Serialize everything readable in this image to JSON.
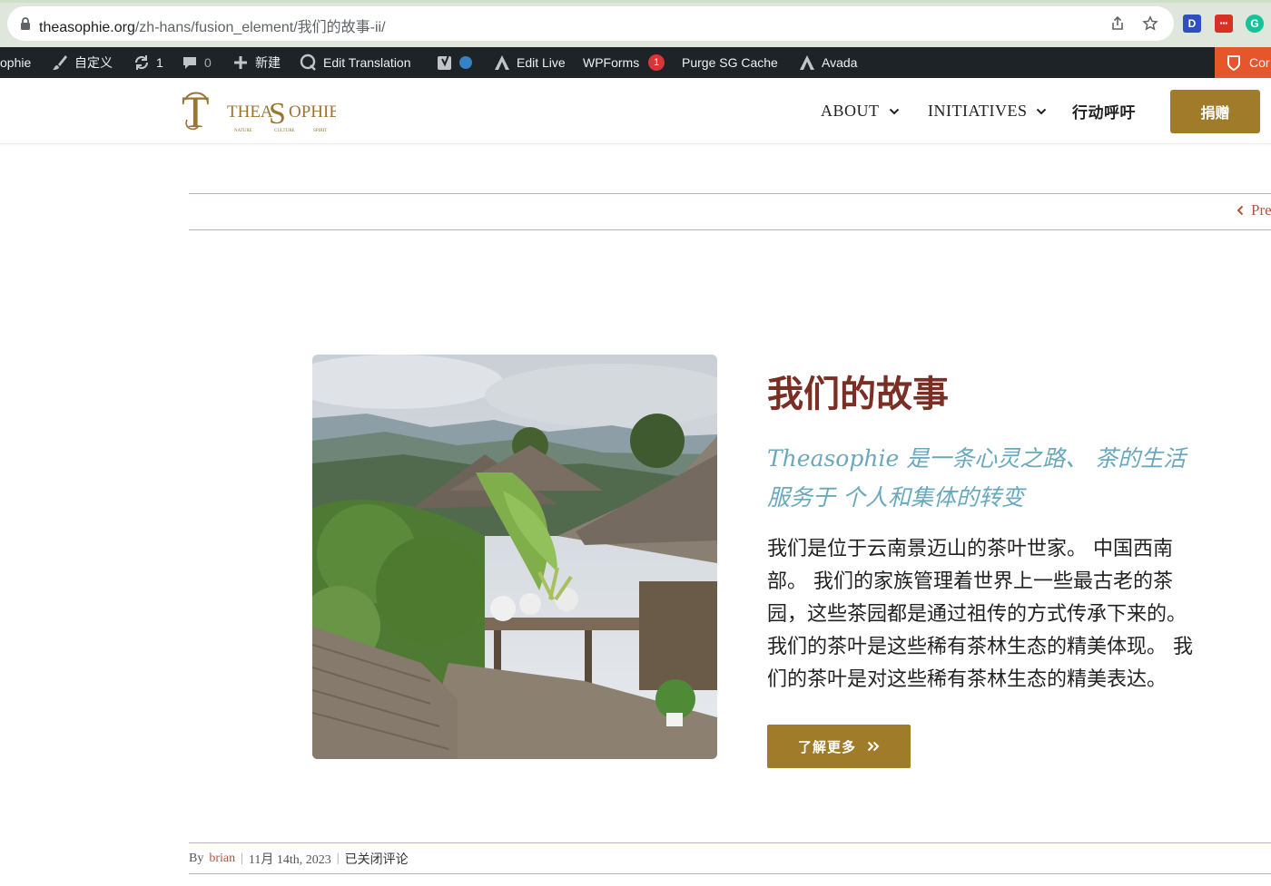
{
  "browser": {
    "url_domain": "theasophie.org",
    "url_path": "/zh-hans/fusion_element/我们的故事-ii/",
    "extensions": [
      {
        "name": "dashlane",
        "label": "D",
        "color": "#2f4fbf"
      },
      {
        "name": "extension-red",
        "label": "▪▪▪",
        "color": "#d93025"
      },
      {
        "name": "grammarly",
        "label": "G",
        "color": "#15c39a"
      }
    ]
  },
  "admin_bar": {
    "site": "ophie",
    "customize": "自定义",
    "updates_count": "1",
    "comments_count": "0",
    "new": "新建",
    "edit_translation": "Edit Translation",
    "edit_live": "Edit Live",
    "wpforms": "WPForms",
    "wpforms_badge": "1",
    "purge_cache": "Purge SG Cache",
    "avada": "Avada",
    "right_item": "Cor"
  },
  "header": {
    "logo_text": "THEASOPHIE",
    "logo_sub": [
      "NATURE",
      "CULTURE",
      "SPIRIT"
    ],
    "nav": [
      {
        "label": "ABOUT",
        "dropdown": true
      },
      {
        "label": "INITIATIVES",
        "dropdown": true
      },
      {
        "label": "行动呼吁",
        "dropdown": false
      }
    ],
    "donate_label": "捐赠"
  },
  "pagination": {
    "prev_label": "Pre"
  },
  "story": {
    "title": "我们的故事",
    "tagline_lines": [
      "Theasophie 是一条心灵之路、 茶的生活",
      "服务于 个人和集体的转变"
    ],
    "body_lines": [
      "我们是位于云南景迈山的茶叶世家。 中国西南",
      "部。 我们的家族管理着世界上一些最古老的茶",
      "园，这些茶园都是通过祖传的方式传承下来的。",
      "我们的茶叶是这些稀有茶林生态的精美体现。 我",
      "们的茶叶是对这些稀有茶林生态的精美表达。"
    ],
    "more_label": "了解更多"
  },
  "meta": {
    "by": "By",
    "author": "brian",
    "date": "11月 14th, 2023",
    "comments": "已关闭评论"
  },
  "colors": {
    "gold": "#a07c2a",
    "title_red": "#7a2e24",
    "tagline_blue": "#6aa8bd",
    "link_red": "#b0563a"
  }
}
